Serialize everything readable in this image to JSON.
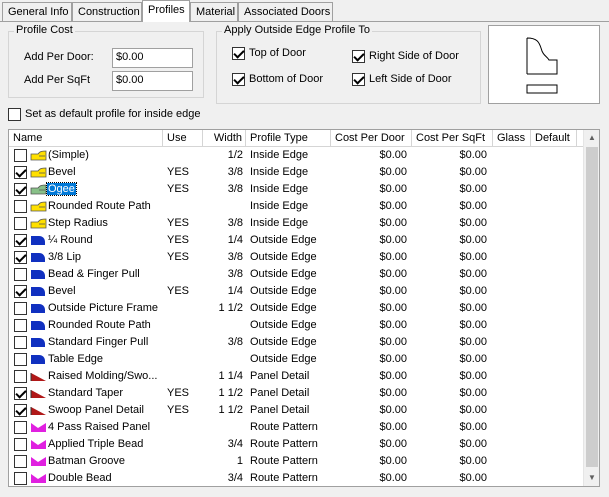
{
  "tabs": [
    "General Info",
    "Construction",
    "Profiles",
    "Material",
    "Associated Doors"
  ],
  "profile_cost": {
    "title": "Profile Cost",
    "per_door_label": "Add Per Door:",
    "per_door_value": "$0.00",
    "per_sqft_label": "Add Per SqFt",
    "per_sqft_value": "$0.00"
  },
  "outside_edge": {
    "title": "Apply Outside Edge Profile To",
    "top_label": "Top of Door",
    "top_checked": true,
    "bottom_label": "Bottom of Door",
    "bottom_checked": true,
    "right_label": "Right Side of Door",
    "right_checked": true,
    "left_label": "Left Side of Door",
    "left_checked": true
  },
  "default_profile": {
    "label": "Set as default profile for inside edge",
    "checked": false
  },
  "columns": [
    "Name",
    "Use",
    "Width",
    "Profile Type",
    "Cost Per Door",
    "Cost Per SqFt",
    "Glass",
    "Default"
  ],
  "rows": [
    {
      "checked": false,
      "icon": "inside-edge",
      "name": "(Simple)",
      "use": "",
      "width": "1/2",
      "type": "Inside Edge",
      "cost_door": "$0.00",
      "cost_sqft": "$0.00"
    },
    {
      "checked": true,
      "icon": "inside-edge",
      "name": "Bevel",
      "use": "YES",
      "width": "3/8",
      "type": "Inside Edge",
      "cost_door": "$0.00",
      "cost_sqft": "$0.00"
    },
    {
      "checked": true,
      "icon": "inside-edge-ogee",
      "name": "Ogee",
      "use": "YES",
      "width": "3/8",
      "type": "Inside Edge",
      "cost_door": "$0.00",
      "cost_sqft": "$0.00",
      "selected": true
    },
    {
      "checked": false,
      "icon": "inside-edge",
      "name": "Rounded Route Path",
      "use": "",
      "width": "",
      "type": "Inside Edge",
      "cost_door": "$0.00",
      "cost_sqft": "$0.00"
    },
    {
      "checked": false,
      "icon": "inside-edge",
      "name": "Step Radius",
      "use": "YES",
      "width": "3/8",
      "type": "Inside Edge",
      "cost_door": "$0.00",
      "cost_sqft": "$0.00"
    },
    {
      "checked": true,
      "icon": "outside-edge",
      "name": "¼ Round",
      "use": "YES",
      "width": "1/4",
      "type": "Outside Edge",
      "cost_door": "$0.00",
      "cost_sqft": "$0.00"
    },
    {
      "checked": true,
      "icon": "outside-edge",
      "name": "3/8 Lip",
      "use": "YES",
      "width": "3/8",
      "type": "Outside Edge",
      "cost_door": "$0.00",
      "cost_sqft": "$0.00"
    },
    {
      "checked": false,
      "icon": "outside-edge",
      "name": "Bead & Finger Pull",
      "use": "",
      "width": "3/8",
      "type": "Outside Edge",
      "cost_door": "$0.00",
      "cost_sqft": "$0.00"
    },
    {
      "checked": true,
      "icon": "outside-edge",
      "name": "Bevel",
      "use": "YES",
      "width": "1/4",
      "type": "Outside Edge",
      "cost_door": "$0.00",
      "cost_sqft": "$0.00"
    },
    {
      "checked": false,
      "icon": "outside-edge",
      "name": "Outside Picture Frame",
      "use": "",
      "width": "1 1/2",
      "type": "Outside Edge",
      "cost_door": "$0.00",
      "cost_sqft": "$0.00"
    },
    {
      "checked": false,
      "icon": "outside-edge",
      "name": "Rounded Route Path",
      "use": "",
      "width": "",
      "type": "Outside Edge",
      "cost_door": "$0.00",
      "cost_sqft": "$0.00"
    },
    {
      "checked": false,
      "icon": "outside-edge",
      "name": "Standard Finger Pull",
      "use": "",
      "width": "3/8",
      "type": "Outside Edge",
      "cost_door": "$0.00",
      "cost_sqft": "$0.00"
    },
    {
      "checked": false,
      "icon": "outside-edge",
      "name": "Table Edge",
      "use": "",
      "width": "",
      "type": "Outside Edge",
      "cost_door": "$0.00",
      "cost_sqft": "$0.00"
    },
    {
      "checked": false,
      "icon": "panel-detail",
      "name": "Raised Molding/Swo...",
      "use": "",
      "width": "1 1/4",
      "type": "Panel Detail",
      "cost_door": "$0.00",
      "cost_sqft": "$0.00"
    },
    {
      "checked": true,
      "icon": "panel-detail",
      "name": "Standard Taper",
      "use": "YES",
      "width": "1 1/2",
      "type": "Panel Detail",
      "cost_door": "$0.00",
      "cost_sqft": "$0.00"
    },
    {
      "checked": true,
      "icon": "panel-detail",
      "name": "Swoop Panel Detail",
      "use": "YES",
      "width": "1 1/2",
      "type": "Panel Detail",
      "cost_door": "$0.00",
      "cost_sqft": "$0.00"
    },
    {
      "checked": false,
      "icon": "route-pattern",
      "name": "4 Pass Raised Panel",
      "use": "",
      "width": "",
      "type": "Route Pattern",
      "cost_door": "$0.00",
      "cost_sqft": "$0.00"
    },
    {
      "checked": false,
      "icon": "route-pattern",
      "name": "Applied Triple Bead",
      "use": "",
      "width": "3/4",
      "type": "Route Pattern",
      "cost_door": "$0.00",
      "cost_sqft": "$0.00"
    },
    {
      "checked": false,
      "icon": "route-pattern",
      "name": "Batman Groove",
      "use": "",
      "width": "1",
      "type": "Route Pattern",
      "cost_door": "$0.00",
      "cost_sqft": "$0.00"
    },
    {
      "checked": false,
      "icon": "route-pattern",
      "name": "Double Bead",
      "use": "",
      "width": "3/4",
      "type": "Route Pattern",
      "cost_door": "$0.00",
      "cost_sqft": "$0.00"
    }
  ],
  "colors": {
    "inside_edge": "#ffe000",
    "outside_edge": "#1030c0",
    "panel_detail": "#b01818",
    "route_pattern": "#e020e0",
    "selection": "#0078d7"
  }
}
